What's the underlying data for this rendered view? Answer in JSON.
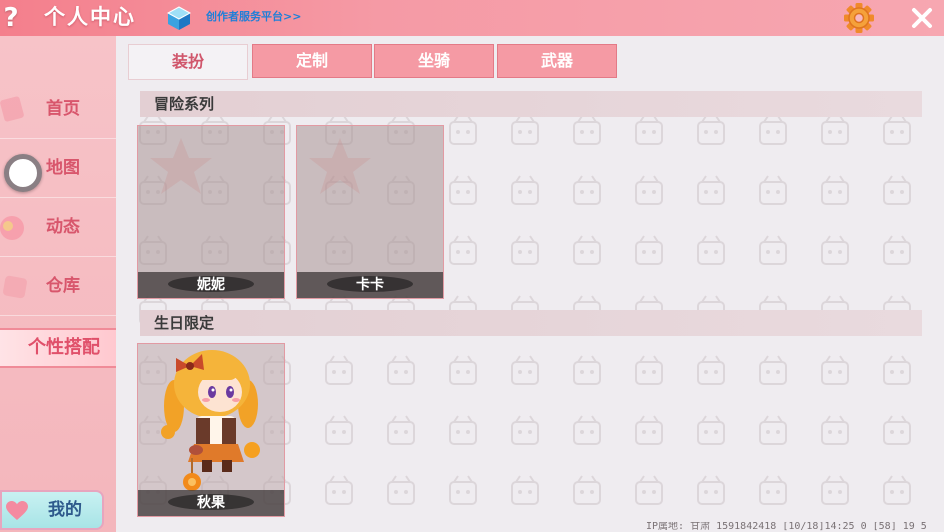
{
  "header": {
    "help_icon": "question-mark-icon",
    "title": "个人中心",
    "creator_link": "创作者服务平台>>",
    "settings_icon": "gear-icon",
    "close_icon": "close-icon"
  },
  "sidebar": {
    "items": [
      {
        "label": "首页"
      },
      {
        "label": "地图"
      },
      {
        "label": "动态"
      },
      {
        "label": "仓库"
      },
      {
        "label": "个性搭配"
      }
    ],
    "my_button": "我的"
  },
  "tabs": [
    {
      "label": "装扮",
      "active": true
    },
    {
      "label": "定制",
      "active": false
    },
    {
      "label": "坐骑",
      "active": false
    },
    {
      "label": "武器",
      "active": false
    }
  ],
  "sections": [
    {
      "title": "冒险系列",
      "items": [
        {
          "name": "妮妮",
          "locked": true
        },
        {
          "name": "卡卡",
          "locked": true
        }
      ]
    },
    {
      "title": "生日限定",
      "items": [
        {
          "name": "秋果",
          "locked": false
        }
      ]
    }
  ],
  "footer": {
    "info": "IP属地: 甘肃    1591842418  [10/18]14:25 0  [58] 19 5"
  },
  "colors": {
    "header_pink": "#f47f8c",
    "sidebar_pink": "#f7c3c8",
    "label_red": "#d8566c",
    "tab_pink": "#f59aa4"
  }
}
